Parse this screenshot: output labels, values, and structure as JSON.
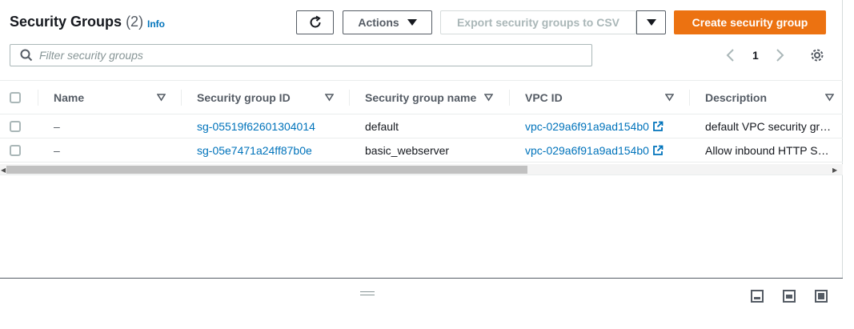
{
  "header": {
    "title": "Security Groups",
    "count": "(2)",
    "info_link": "Info"
  },
  "toolbar": {
    "actions_label": "Actions",
    "export_label": "Export security groups to CSV",
    "create_label": "Create security group"
  },
  "filter": {
    "placeholder": "Filter security groups"
  },
  "pagination": {
    "current_page": "1"
  },
  "table": {
    "columns": [
      "Name",
      "Security group ID",
      "Security group name",
      "VPC ID",
      "Description"
    ],
    "rows": [
      {
        "name": "–",
        "sg_id": "sg-05519f62601304014",
        "sg_name": "default",
        "vpc_id": "vpc-029a6f91a9ad154b0",
        "description": "default VPC security gr…"
      },
      {
        "name": "–",
        "sg_id": "sg-05e7471a24ff87b0e",
        "sg_name": "basic_webserver",
        "vpc_id": "vpc-029a6f91a9ad154b0",
        "description": "Allow inbound HTTP S…"
      }
    ]
  },
  "colors": {
    "primary": "#ec7211",
    "link": "#0073bb"
  },
  "icons": [
    "refresh-icon",
    "caret-down-icon",
    "search-icon",
    "chevron-left-icon",
    "chevron-right-icon",
    "settings-icon",
    "sort-icon",
    "external-link-icon",
    "drag-handle-icon",
    "panel-layout-icon"
  ]
}
